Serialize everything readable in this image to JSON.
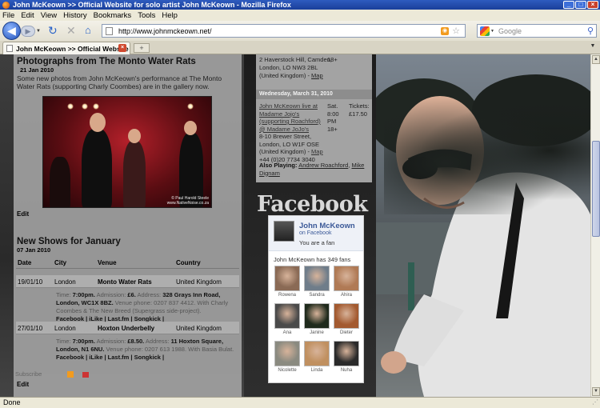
{
  "window": {
    "title": "John McKeown >> Official Website for solo artist John McKeown - Mozilla Firefox",
    "min_icon": "minimize-glyph",
    "max_icon": "maximize-glyph",
    "close_icon": "close-glyph"
  },
  "menu": [
    "File",
    "Edit",
    "View",
    "History",
    "Bookmarks",
    "Tools",
    "Help"
  ],
  "nav": {
    "url": "http://www.johnmckeown.net/",
    "search_placeholder": "Google"
  },
  "tabs": [
    {
      "label": "John McKeown >> Official Website f..."
    }
  ],
  "post": {
    "title": "Photographs from The Monto Water Rats",
    "date": "21 Jan 2010",
    "text": "Some new photos from John McKeown's performance at The Monto Water Rats (supporting Charly Coombes) are in the gallery now.",
    "photo_credit_line1": "© Paul Harold Steele",
    "photo_credit_line2": "www.NativeNoise.co.za",
    "edit": "Edit"
  },
  "shows": {
    "title": "New Shows for January",
    "date": "07 Jan 2010",
    "headers": {
      "date": "Date",
      "city": "City",
      "venue": "Venue",
      "country": "Country"
    },
    "rows": [
      {
        "date": "19/01/10",
        "city": "London",
        "venue": "Monto Water Rats",
        "country": "United Kingdom",
        "time_label": "Time:",
        "time": "7:00pm.",
        "admission_label": "Admission:",
        "admission": "£6.",
        "address_label": "Address:",
        "address": "328 Grays Inn Road, London, WC1X 8BZ.",
        "phone_label": "Venue phone:",
        "phone": "0207 837 4412.",
        "with": "With Charly Coombes & The New Breed (Supergrass side-project).",
        "links": [
          "Facebook",
          "iLike",
          "Last.fm",
          "Songkick"
        ]
      },
      {
        "date": "27/01/10",
        "city": "London",
        "venue": "Hoxton Underbelly",
        "country": "United Kingdom",
        "time_label": "Time:",
        "time": "7:00pm.",
        "admission_label": "Admission:",
        "admission": "£8.50.",
        "address_label": "Address:",
        "address": "11 Hoxton Square, London, N1 6NU.",
        "phone_label": "Venue phone:",
        "phone": "0207 613 1988.",
        "with": "With Basia Bulat.",
        "links": [
          "Facebook",
          "iLike",
          "Last.fm",
          "Songkick"
        ]
      }
    ],
    "subscribe": "Subscribe",
    "edit": "Edit"
  },
  "events": {
    "prev_address": "2 Haverstock Hill, Camden, London, LO NW3 2BL (United Kingdom) -",
    "prev_map": "Map",
    "prev_age": "18+",
    "day_header": "Wednesday, March 31, 2010",
    "event_title": "John McKeown live at Madame Jojo's (supporting Roachford) @ Madame JoJo's",
    "event_address": "8-10 Brewer Street, London, LO W1F OSE (United Kingdom) -",
    "event_map": "Map",
    "event_phone": "+44 (0)20 7734 3040",
    "time_lines": [
      "Sat.",
      "8:00",
      "PM",
      "18+"
    ],
    "tickets_label": "Tickets:",
    "tickets_price": "£17.50",
    "also_label": "Also Playing:",
    "also_1": "Andrew Roachford",
    "also_2": "Mike Dignam"
  },
  "facebook": {
    "heading": "Facebook",
    "name": "John McKeown",
    "on": "on Facebook",
    "fan_status": "You are a fan",
    "fan_count": "John McKeown has 349 fans",
    "fans": [
      {
        "name": "Rowena",
        "color": "#8a6a55"
      },
      {
        "name": "Sandra",
        "color": "#6f7d8a"
      },
      {
        "name": "Ahira",
        "color": "#b07a55"
      },
      {
        "name": "Ana",
        "color": "#4a4a4a"
      },
      {
        "name": "Janine",
        "color": "#1f2a1c"
      },
      {
        "name": "Dieter",
        "color": "#a35a30"
      },
      {
        "name": "Nicolette",
        "color": "#8a8a80"
      },
      {
        "name": "Linda",
        "color": "#c09060"
      },
      {
        "name": "Nuha",
        "color": "#2a2a2a"
      }
    ]
  },
  "status": "Done"
}
